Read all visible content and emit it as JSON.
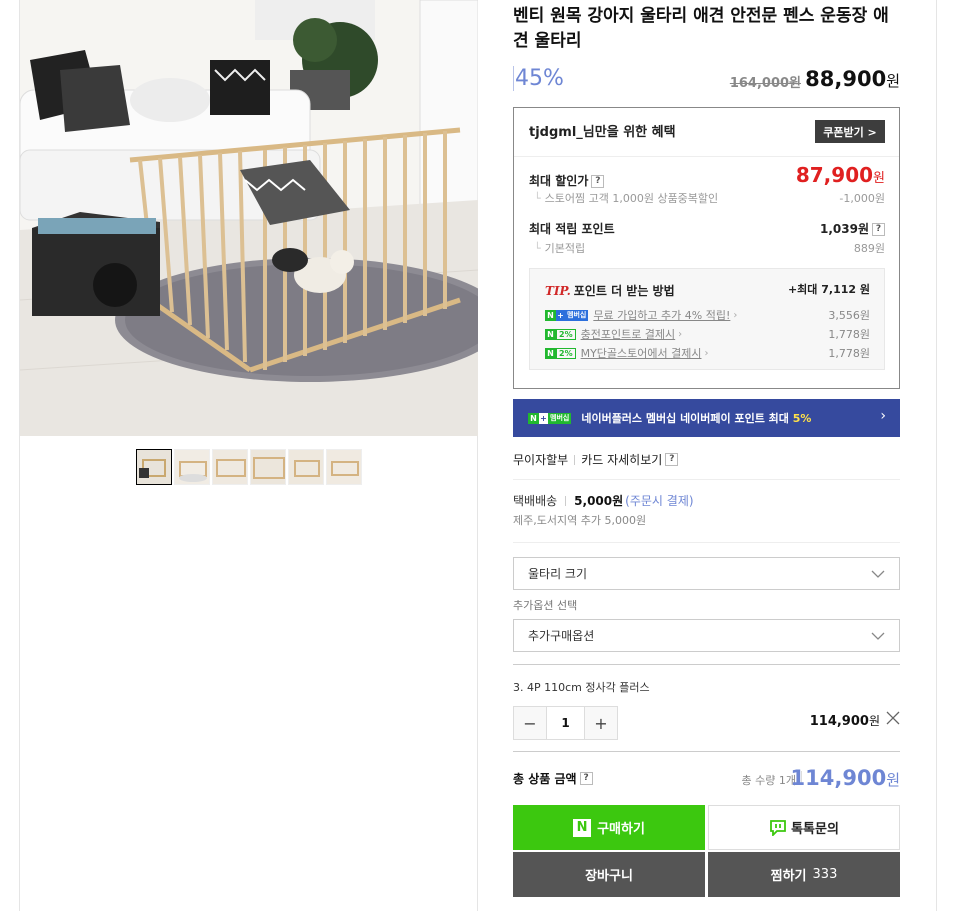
{
  "product": {
    "title": "벤티 원목 강아지 울타리 애견 안전문 펜스 운동장 애견 울타리",
    "discount_rate": "45%",
    "original_price": "164,000원",
    "final_price": "88,900",
    "won": "원"
  },
  "benefit": {
    "heading": "tjdgml_님만을 위한 혜택",
    "coupon_button": "쿠폰받기 >",
    "max_discount_label": "최대 할인가",
    "max_discount_value": "87,900",
    "max_discount_sub_label": "스토어찜 고객 1,000원 상품중복할인",
    "max_discount_sub_value": "-1,000원",
    "max_points_label": "최대 적립 포인트",
    "max_points_value": "1,039원",
    "basic_points_label": "기본적립",
    "basic_points_value": "889원",
    "help": "?"
  },
  "tip": {
    "tip_word": "TIP.",
    "heading": "포인트 더 받는 방법",
    "max": "+최대 7,112 원",
    "rows": [
      {
        "badge": "멤버십",
        "text": "무료 가입하고 추가 4% 적립!",
        "value": "3,556원"
      },
      {
        "badge": "2%",
        "text": "충전포인트로 결제시",
        "value": "1,778원"
      },
      {
        "badge": "2%",
        "text": "MY단골스토어에서 결제시",
        "value": "1,778원"
      }
    ]
  },
  "membership_banner": {
    "badge": "멤버십",
    "text": "네이버플러스 멤버십 네이버페이 포인트 최대",
    "highlight": "5%",
    "arrow": "›"
  },
  "payment": {
    "installment": "무이자할부",
    "card_detail": "카드 자세히보기"
  },
  "shipping": {
    "method": "택배배송",
    "price": "5,000원",
    "note": "(주문시 결제)",
    "extra": "제주,도서지역 추가 5,000원"
  },
  "options": {
    "select1": "울타리 크기",
    "additional_label": "추가옵션 선택",
    "select2": "추가구매옵션"
  },
  "selected": {
    "name": "3. 4P 110cm 정사각 플러스",
    "minus": "−",
    "qty": "1",
    "plus": "+",
    "price": "114,900",
    "won": "원"
  },
  "total": {
    "label": "총 상품 금액",
    "qty": "총 수량 1개",
    "price": "114,900",
    "won": "원"
  },
  "actions": {
    "buy": "구매하기",
    "buy_logo": "N",
    "talk": "톡톡문의",
    "cart": "장바구니",
    "wish": "찜하기",
    "wish_count": "333"
  }
}
